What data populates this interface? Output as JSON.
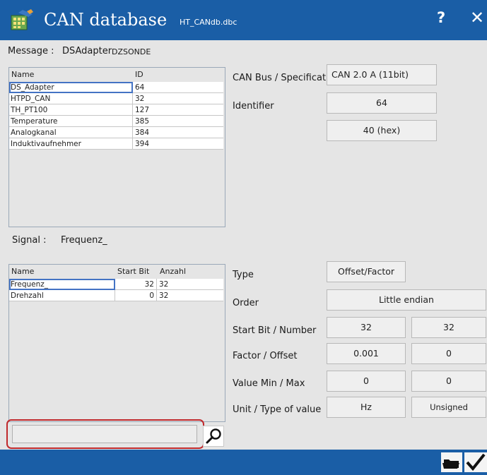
{
  "window": {
    "title": "CAN database",
    "file": "HT_CANdb.dbc",
    "help_label": "?",
    "close_label": "✕"
  },
  "message": {
    "label": "Message :",
    "name": "DSAdapter",
    "id_name": "DZSONDE",
    "columns": [
      "Name",
      "ID"
    ],
    "rows": [
      {
        "name": "DS_Adapter",
        "id": "64"
      },
      {
        "name": "HTPD_CAN",
        "id": "32"
      },
      {
        "name": "TH_PT100",
        "id": "127"
      },
      {
        "name": "Temperature",
        "id": "385"
      },
      {
        "name": "Analogkanal",
        "id": "384"
      },
      {
        "name": "Induktivaufnehmer",
        "id": "394"
      }
    ]
  },
  "message_props": {
    "bus_label": "CAN Bus / Specificati",
    "bus_value": "CAN 2.0 A (11bit)",
    "identifier_label": "Identifier",
    "identifier_dec": "64",
    "identifier_hex": "40 (hex)"
  },
  "signal": {
    "label": "Signal :",
    "name": "Frequenz_",
    "columns": [
      "Name",
      "Start Bit",
      "Anzahl"
    ],
    "rows": [
      {
        "name": "Frequenz_",
        "start": "32",
        "count": "32"
      },
      {
        "name": "Drehzahl",
        "start": "0",
        "count": "32"
      }
    ]
  },
  "signal_props": {
    "type_label": "Type",
    "type_value": "Offset/Factor",
    "order_label": "Order",
    "order_value": "Little endian",
    "startbit_label": "Start Bit / Number",
    "startbit_value": "32",
    "number_value": "32",
    "factor_label": "Factor / Offset",
    "factor_value": "0.001",
    "offset_value": "0",
    "value_label": "Value Min / Max",
    "min_value": "0",
    "max_value": "0",
    "unit_label": "Unit / Type of value",
    "unit_value": "Hz",
    "valuetype_value": "Unsigned"
  },
  "search": {
    "value": ""
  },
  "colors": {
    "titlebar": "#1a5ea6",
    "panel": "#e5e5e5",
    "highlight": "#c0292c",
    "selection": "#4473c4"
  },
  "icons": [
    "database-icon",
    "help-icon",
    "close-icon",
    "search-icon",
    "folder-icon",
    "checkmark-icon"
  ]
}
